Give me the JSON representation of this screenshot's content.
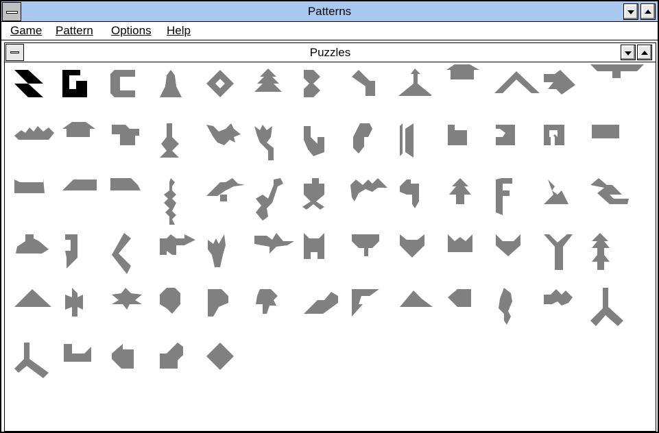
{
  "window": {
    "title": "Patterns"
  },
  "menu": [
    {
      "label": "Game"
    },
    {
      "label": "Pattern"
    },
    {
      "label": "Options"
    },
    {
      "label": "Help"
    }
  ],
  "child_window": {
    "title": "Puzzles"
  },
  "puzzles": {
    "count": 74,
    "selected_style_count": 2,
    "tile_color": "#808080",
    "solved_color": "#000000"
  }
}
